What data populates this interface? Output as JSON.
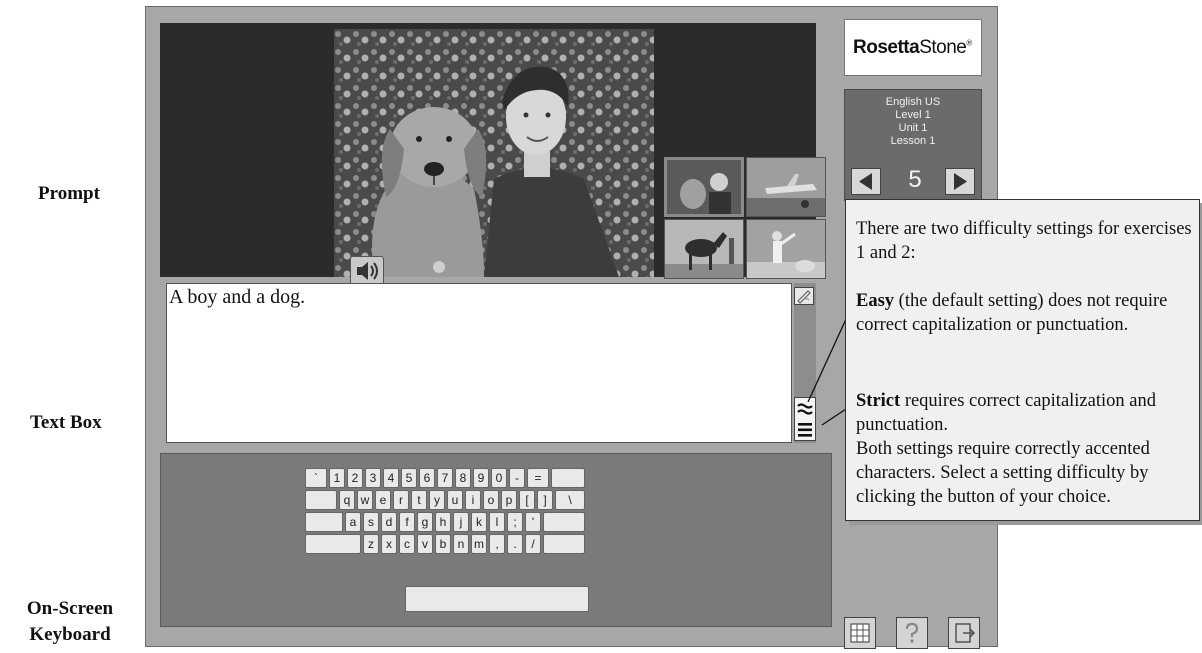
{
  "labels": {
    "prompt": "Prompt",
    "textbox": "Text Box",
    "keyboard_line1": "On-Screen",
    "keyboard_line2": "Keyboard"
  },
  "app": {
    "logo": {
      "bold": "Rosetta",
      "regular": "Stone",
      "mark": "®"
    },
    "lesson_info": [
      "English US",
      "Level 1",
      "Unit 1",
      "Lesson 1"
    ],
    "page_number": "5",
    "textbox_text": "A boy and a dog."
  },
  "keyboard": {
    "rows": [
      [
        "`",
        "1",
        "2",
        "3",
        "4",
        "5",
        "6",
        "7",
        "8",
        "9",
        "0",
        "-",
        "="
      ],
      [
        "q",
        "w",
        "e",
        "r",
        "t",
        "y",
        "u",
        "i",
        "o",
        "p",
        "[",
        "]",
        "\\"
      ],
      [
        "a",
        "s",
        "d",
        "f",
        "g",
        "h",
        "j",
        "k",
        "l",
        ";",
        "'"
      ],
      [
        "z",
        "x",
        "c",
        "v",
        "b",
        "n",
        "m",
        ",",
        ".",
        "/"
      ]
    ]
  },
  "callout": {
    "intro": "There are two difficulty settings for exercises 1 and 2:",
    "easy_term": "Easy",
    "easy_text": " (the default setting) does not require correct capitalization or punctuation.",
    "strict_term": "Strict",
    "strict_text": " requires correct capitalization and punctuation.",
    "outro": "Both settings require correctly accented characters. Select a setting difficulty by clicking the button of your choice."
  },
  "icons": {
    "speaker": "speaker-icon",
    "pencil": "pencil-icon",
    "easy_setting": "easy-setting-icon",
    "strict_setting": "strict-setting-icon",
    "prev": "arrow-left-icon",
    "next": "arrow-right-icon",
    "help": "question-icon"
  }
}
